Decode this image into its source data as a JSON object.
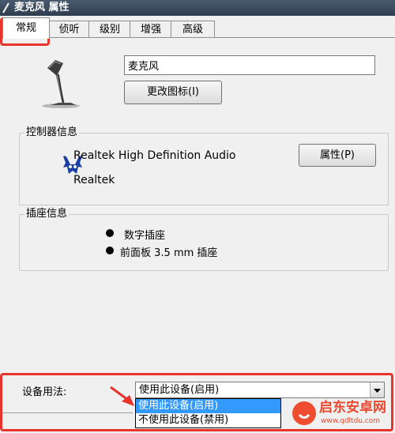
{
  "window": {
    "title": "麦克风 属性"
  },
  "tabs": [
    {
      "label": "常规",
      "active": true
    },
    {
      "label": "侦听"
    },
    {
      "label": "级别"
    },
    {
      "label": "增强"
    },
    {
      "label": "高级"
    }
  ],
  "general": {
    "device_name": "麦克风",
    "change_icon_label": "更改图标(I)"
  },
  "controller": {
    "group_label": "控制器信息",
    "name": "Realtek High Definition Audio",
    "vendor": "Realtek",
    "properties_label": "属性(P)"
  },
  "jack": {
    "group_label": "插座信息",
    "items": [
      "数字插座",
      "前面板 3.5 mm 插座"
    ]
  },
  "usage": {
    "label": "设备用法:",
    "selected": "使用此设备(启用)",
    "options": [
      "使用此设备(启用)",
      "不使用此设备(禁用)"
    ]
  },
  "watermark": {
    "text": "启东安卓网",
    "url": "www.qdltdu.com"
  },
  "colors": {
    "annotation": "#e8342c",
    "selection": "#3399ff"
  }
}
